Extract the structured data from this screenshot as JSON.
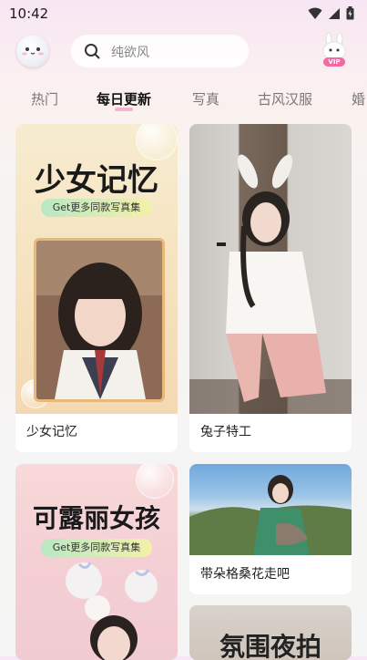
{
  "status": {
    "time": "10:42"
  },
  "search": {
    "placeholder": "纯欲风"
  },
  "vip_badge": "VIP",
  "tabs": [
    {
      "label": "热门",
      "active": false
    },
    {
      "label": "每日更新",
      "active": true
    },
    {
      "label": "写真",
      "active": false
    },
    {
      "label": "古风汉服",
      "active": false
    },
    {
      "label": "婚",
      "active": false
    }
  ],
  "cards": [
    {
      "caption": "少女记忆",
      "poster_title": "少女记忆",
      "poster_pill": "Get更多同款写真集"
    },
    {
      "caption": "兔子特工"
    },
    {
      "poster_title": "可露丽女孩",
      "poster_pill": "Get更多同款写真集"
    },
    {
      "caption": "带朵格桑花走吧"
    },
    {
      "poster_title": "氛围夜拍"
    }
  ],
  "colors": {
    "accent": "#f08ab8",
    "pill_start": "#b9e7c4",
    "pill_end": "#f3f1a9"
  }
}
